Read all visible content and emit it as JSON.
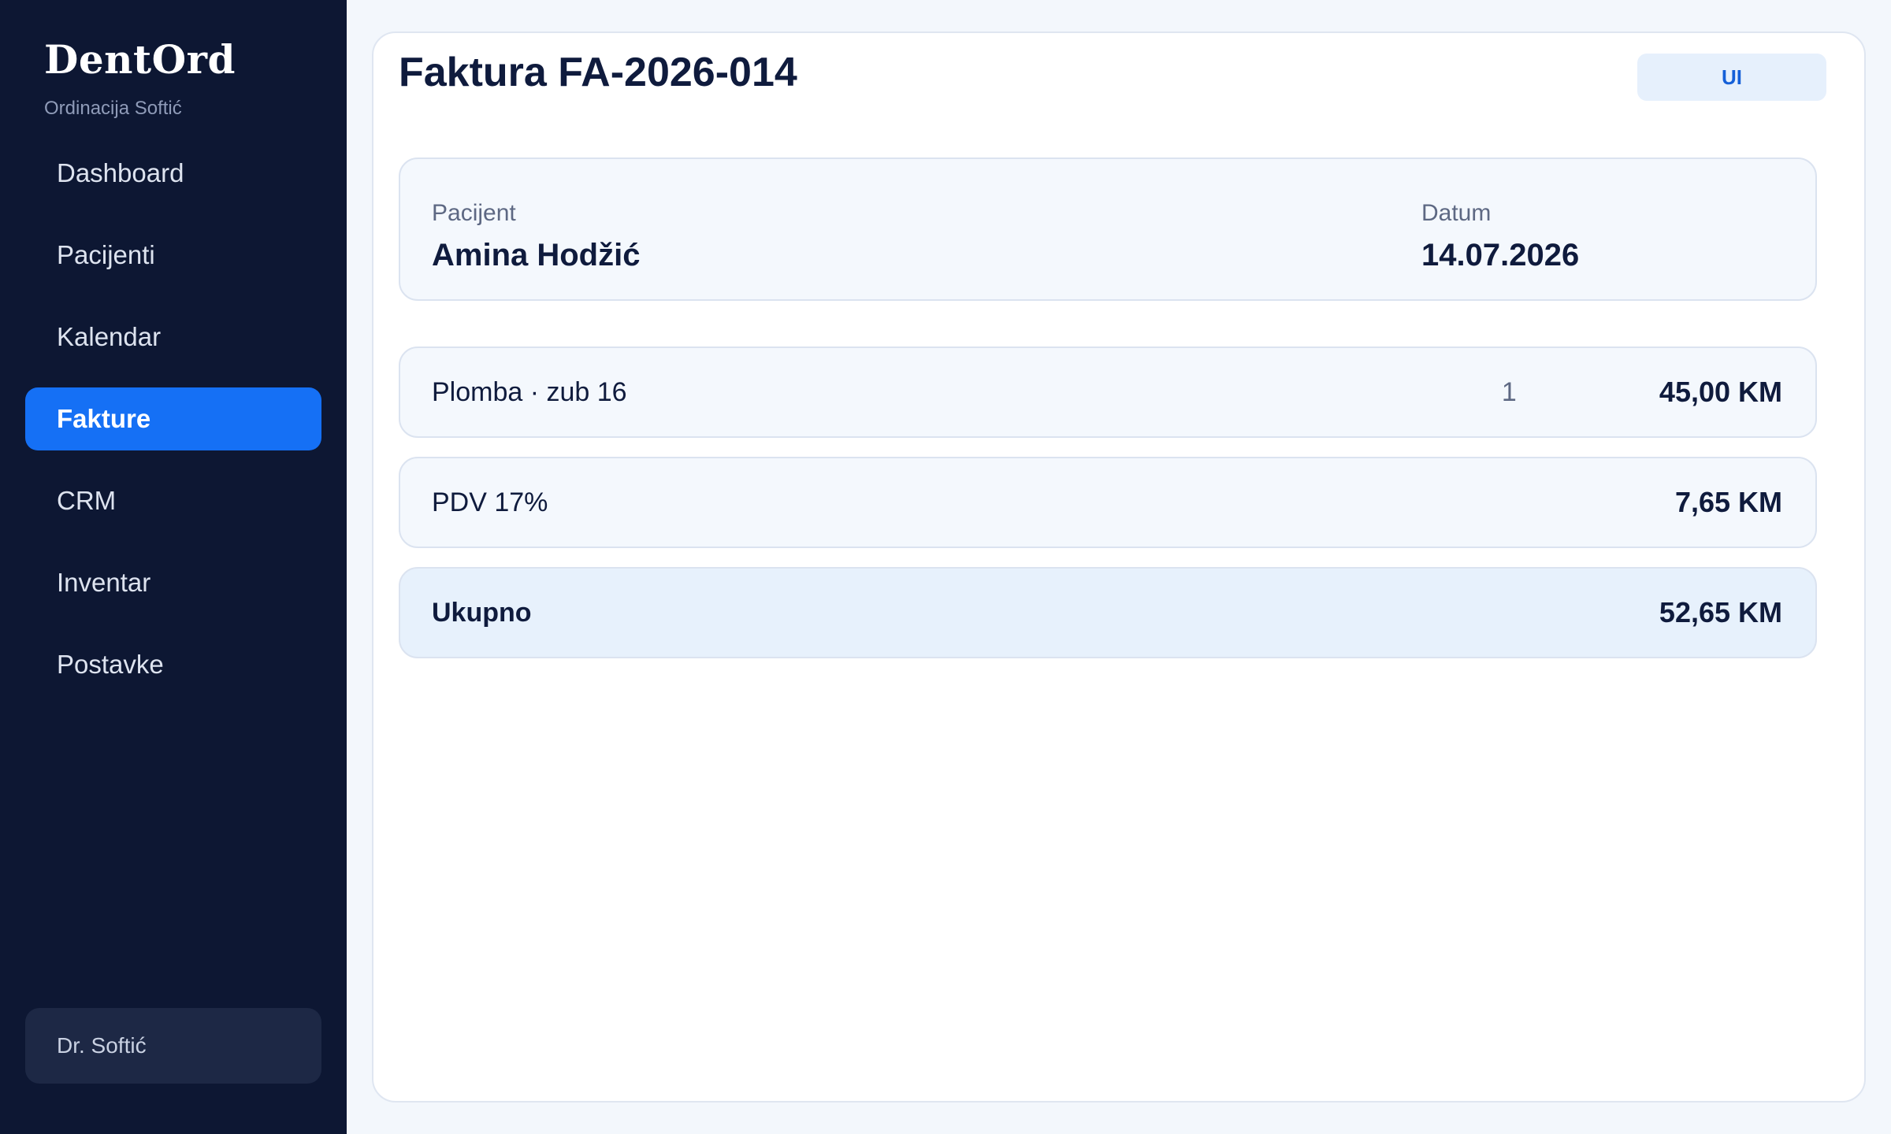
{
  "sidebar": {
    "brand": "DentOrd",
    "subtitle": "Ordinacija Softić",
    "items": [
      {
        "label": "Dashboard"
      },
      {
        "label": "Pacijenti"
      },
      {
        "label": "Kalendar"
      },
      {
        "label": "Fakture",
        "active": true
      },
      {
        "label": "CRM"
      },
      {
        "label": "Inventar"
      },
      {
        "label": "Postavke"
      }
    ],
    "user": "Dr. Softić"
  },
  "invoice": {
    "title": "Faktura FA-2026-014",
    "badge": "UI",
    "patient_label": "Pacijent",
    "patient_name": "Amina Hodžić",
    "date_label": "Datum",
    "date": "14.07.2026",
    "items": [
      {
        "description": "Plomba · zub 16",
        "quantity": "1",
        "amount": "45,00 KM"
      }
    ],
    "tax": {
      "label": "PDV 17%",
      "amount": "7,65 KM"
    },
    "total": {
      "label": "Ukupno",
      "amount": "52,65 KM"
    }
  },
  "colors": {
    "sidebar_bg": "#0d1733",
    "accent": "#1570f5",
    "text": "#0f1b3d"
  }
}
